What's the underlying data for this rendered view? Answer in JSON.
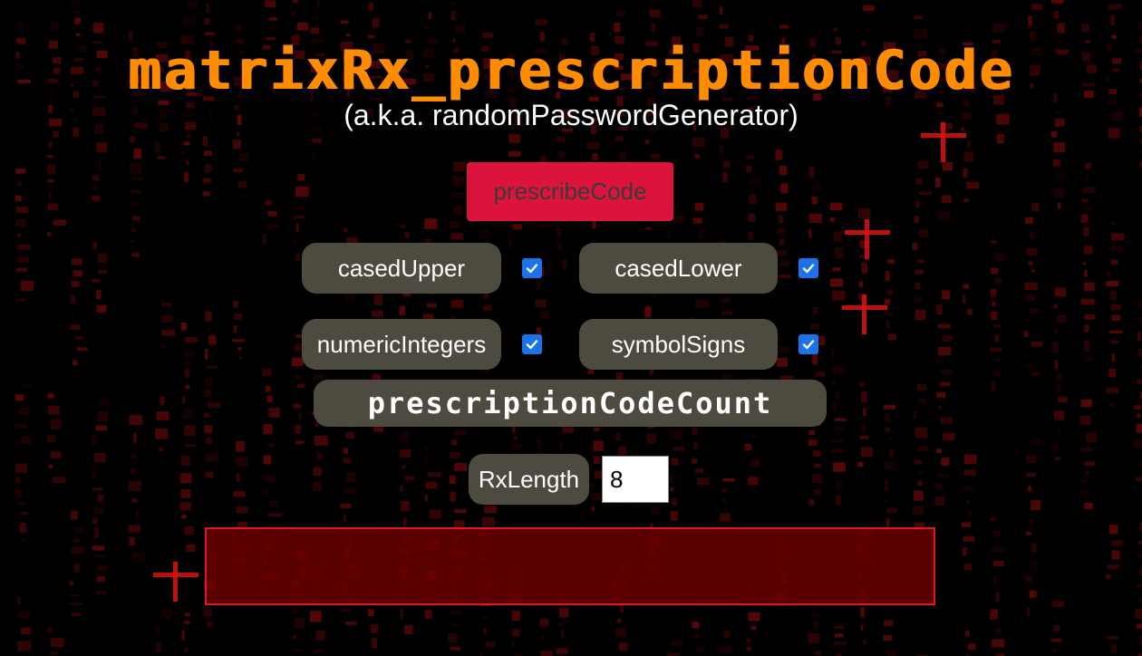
{
  "header": {
    "title": "matrixRx_prescriptionCode",
    "subtitle": "(a.k.a. randomPasswordGenerator)"
  },
  "actions": {
    "generate_label": "prescribeCode"
  },
  "options": [
    {
      "label": "casedUpper",
      "checked": true
    },
    {
      "label": "casedLower",
      "checked": true
    },
    {
      "label": "numericIntegers",
      "checked": true
    },
    {
      "label": "symbolSigns",
      "checked": true
    }
  ],
  "count": {
    "label": "prescriptionCodeCount"
  },
  "length": {
    "label": "RxLength",
    "value": "8"
  },
  "output": {
    "value": ""
  },
  "colors": {
    "title": "#ff8c00",
    "button": "#dc143c",
    "pill": "#4d4a40",
    "checkbox": "#1a73e8",
    "output_bg": "#6e0000",
    "output_border": "#e01a1a",
    "rain": "#e01010"
  },
  "icons": {
    "checkbox": "checkmark-icon"
  }
}
